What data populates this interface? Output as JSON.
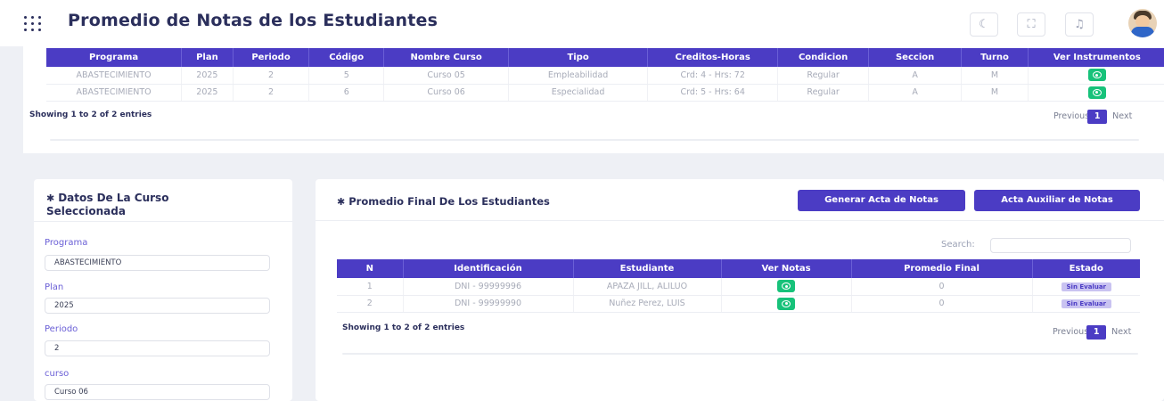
{
  "header": {
    "title": "Promedio de Notas de los Estudiantes",
    "icons": [
      "menu-dots-icon",
      "moon-icon",
      "fullscreen-icon",
      "bell-icon",
      "user-avatar"
    ]
  },
  "courses_table": {
    "columns": [
      "Programa",
      "Plan",
      "Periodo",
      "Código",
      "Nombre Curso",
      "Tipo",
      "Creditos-Horas",
      "Condicion",
      "Seccion",
      "Turno",
      "Ver Instrumentos"
    ],
    "rows": [
      [
        "ABASTECIMIENTO",
        "2025",
        "2",
        "5",
        "Curso 05",
        "Empleabilidad",
        "Crd: 4 - Hrs: 72",
        "Regular",
        "A",
        "M"
      ],
      [
        "ABASTECIMIENTO",
        "2025",
        "2",
        "6",
        "Curso 06",
        "Especialidad",
        "Crd: 5 - Hrs: 64",
        "Regular",
        "A",
        "M"
      ]
    ],
    "showing": "Showing 1 to 2 of 2 entries",
    "prev": "Previous",
    "page": "1",
    "next": "Next"
  },
  "course_data": {
    "title": "Datos De La Curso Seleccionada",
    "fields": [
      {
        "label": "Programa",
        "value": "ABASTECIMIENTO"
      },
      {
        "label": "Plan",
        "value": "2025"
      },
      {
        "label": "Periodo",
        "value": "2"
      },
      {
        "label": "curso",
        "value": "Curso 06"
      }
    ]
  },
  "final_grades": {
    "title": "Promedio Final De Los Estudiantes",
    "btn_acta": "Generar Acta de Notas",
    "btn_auxiliar": "Acta Auxiliar de Notas",
    "search_label": "Search:",
    "columns": [
      "N",
      "Identificación",
      "Estudiante",
      "Ver Notas",
      "Promedio Final",
      "Estado"
    ],
    "rows": [
      {
        "n": "1",
        "id": "DNI - 99999996",
        "student": "APAZA JILL, ALILUO",
        "average": "0",
        "status": "Sin Evaluar"
      },
      {
        "n": "2",
        "id": "DNI - 99999990",
        "student": "Nuñez Perez, LUIS",
        "average": "0",
        "status": "Sin Evaluar"
      }
    ],
    "showing": "Showing 1 to 2 of 2 entries",
    "prev": "Previous",
    "page": "1",
    "next": "Next"
  },
  "colors": {
    "primary": "#4b3cc4",
    "title": "#2b2f5c",
    "success": "#17c27a",
    "badge_bg": "#c9c3f1"
  }
}
